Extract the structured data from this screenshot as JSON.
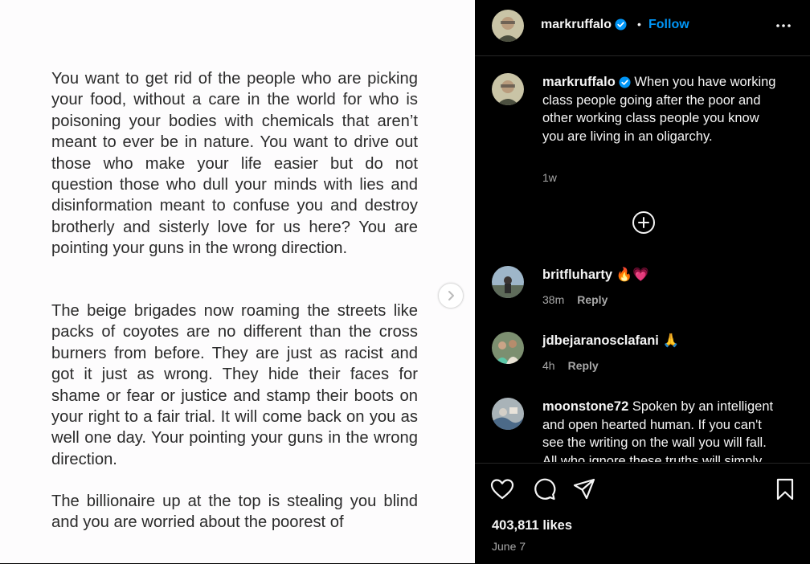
{
  "post_image": {
    "paragraphs": [
      "You want to get rid of the people who are picking your food, without a care in the world for who is poisoning your bodies with chemicals that aren’t meant to ever be in nature. You want to drive out those who make your life easier but do not question those who dull your minds with lies and disinformation meant to confuse you and destroy brotherly and sisterly love for us here? You are pointing your guns in the wrong direction.",
      "The beige brigades now roaming the streets like packs of coyotes are no different than the cross burners from before. They are just as racist and got it just as wrong. They hide their faces for shame or fear or justice and stamp their boots on your right to a fair trial. It will come back on you as well one day. Your pointing your guns in the wrong direction.",
      "The billionaire up at the top is stealing you blind and you are worried about the poorest of"
    ],
    "next_icon": "chevron-right-icon"
  },
  "header": {
    "username": "markruffalo",
    "separator": "•",
    "follow_label": "Follow",
    "more_icon": "more-horizontal-icon"
  },
  "caption": {
    "username": "markruffalo",
    "text": "When you have working class people going after the poor and other working class people you know you are living in an oligarchy.",
    "time": "1w"
  },
  "load_more_icon": "plus-circle-icon",
  "comments": [
    {
      "username": "britfluharty",
      "text": "🔥💗",
      "time": "38m",
      "reply_label": "Reply"
    },
    {
      "username": "jdbejaranosclafani",
      "text": "🙏",
      "time": "4h",
      "reply_label": "Reply"
    },
    {
      "username": "moonstone72",
      "text": "Spoken by an intelligent and open hearted human. If you can't see the writing on the wall you will fall. All who ignore these truths will simply"
    }
  ],
  "actions": {
    "like_icon": "heart-icon",
    "comment_icon": "comment-icon",
    "share_icon": "share-icon",
    "save_icon": "bookmark-icon"
  },
  "likes": "403,811 likes",
  "date": "June 7",
  "colors": {
    "accent": "#0095f6",
    "verified": "#0095f6",
    "background": "#000000",
    "muted": "#a8a8a8"
  }
}
